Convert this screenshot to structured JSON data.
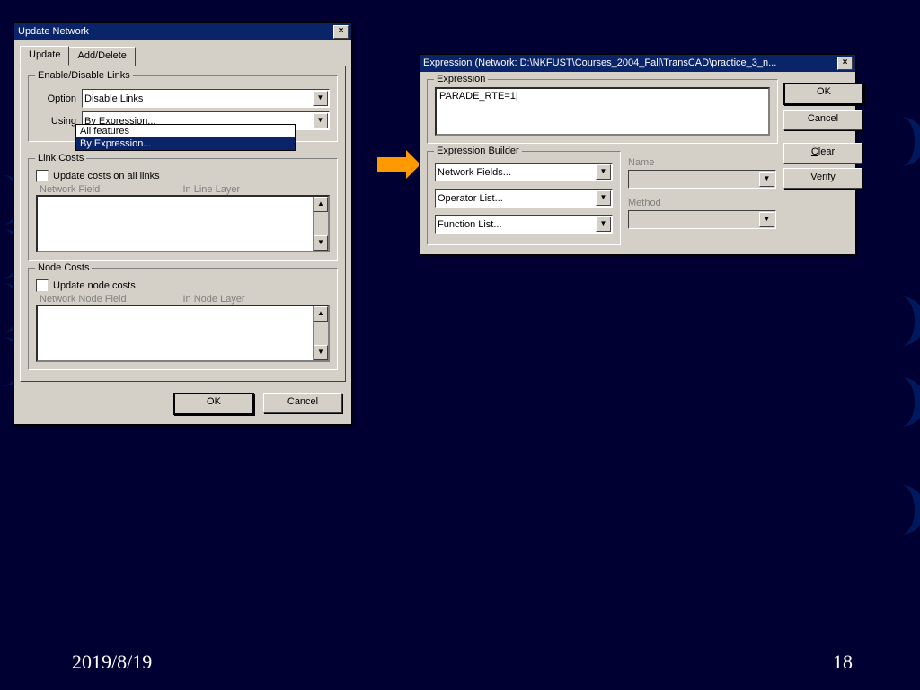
{
  "footer": {
    "date": "2019/8/19",
    "page": "18"
  },
  "dialog1": {
    "title": "Update Network",
    "tabs": {
      "update": "Update",
      "adddelete": "Add/Delete"
    },
    "enable_group": {
      "legend": "Enable/Disable Links",
      "option_label": "Option",
      "option_value": "Disable Links",
      "using_label": "Using",
      "using_value": "By Expression...",
      "dropdown_items": [
        "All features",
        "By Expression..."
      ],
      "dropdown_selected": "By Expression..."
    },
    "linkcosts": {
      "legend": "Link Costs",
      "update_ck": "Update costs on all links",
      "col1": "Network Field",
      "col2": "In Line Layer"
    },
    "nodecosts": {
      "legend": "Node Costs",
      "update_ck": "Update node costs",
      "col1": "Network Node Field",
      "col2": "In Node Layer"
    },
    "ok": "OK",
    "cancel": "Cancel"
  },
  "dialog2": {
    "title": "Expression (Network: D:\\NKFUST\\Courses_2004_Fall\\TransCAD\\practice_3_n...",
    "expr_group": "Expression",
    "expr_value": "PARADE_RTE=1",
    "builder_group": "Expression Builder",
    "combo1": "Network Fields...",
    "combo2": "Operator List...",
    "combo3": "Function List...",
    "name_label": "Name",
    "method_label": "Method",
    "ok": "OK",
    "cancel": "Cancel",
    "clear": "Clear",
    "verify": "Verify"
  }
}
